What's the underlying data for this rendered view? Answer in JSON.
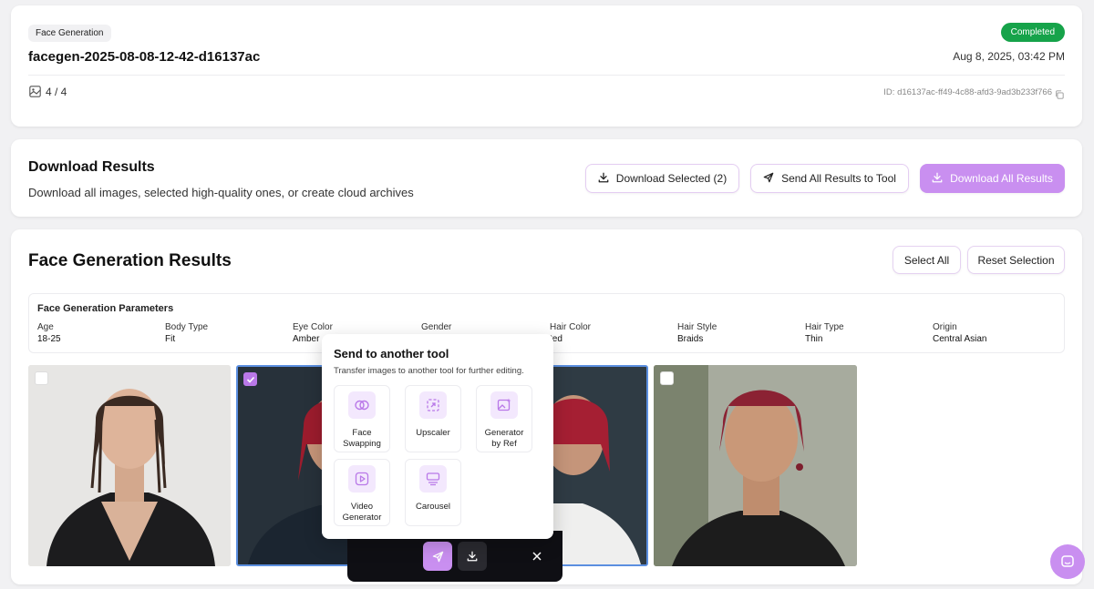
{
  "header": {
    "tag": "Face Generation",
    "job_name": "facegen-2025-08-08-12-42-d16137ac",
    "status": "Completed",
    "datetime": "Aug 8, 2025, 03:42 PM",
    "image_count": "4 / 4",
    "id_text": "ID: d16137ac-ff49-4c88-afd3-9ad3b233f766"
  },
  "download": {
    "title": "Download Results",
    "description": "Download all images, selected high-quality ones, or create cloud archives",
    "download_selected": "Download Selected (2)",
    "send_all": "Send All Results to Tool",
    "download_all": "Download All Results"
  },
  "results": {
    "title": "Face Generation Results",
    "select_all": "Select All",
    "reset_selection": "Reset Selection",
    "params_title": "Face Generation Parameters",
    "params": [
      {
        "label": "Age",
        "value": "18-25"
      },
      {
        "label": "Body Type",
        "value": "Fit"
      },
      {
        "label": "Eye Color",
        "value": "Amber"
      },
      {
        "label": "Gender",
        "value": ""
      },
      {
        "label": "Hair Color",
        "value": "ted"
      },
      {
        "label": "Hair Style",
        "value": "Braids"
      },
      {
        "label": "Hair Type",
        "value": "Thin"
      },
      {
        "label": "Origin",
        "value": "Central Asian"
      }
    ]
  },
  "popup": {
    "title": "Send to another tool",
    "subtitle": "Transfer images to another tool for further editing.",
    "tools": [
      "Face\nSwapping",
      "Upscaler",
      "Generator\nby Ref",
      "Video\nGenerator",
      "Carousel"
    ]
  },
  "colors": {
    "accent": "#c98ff0",
    "accent_dark": "#b978e8",
    "success": "#16a34a",
    "toolbar": "#0f0f14"
  }
}
